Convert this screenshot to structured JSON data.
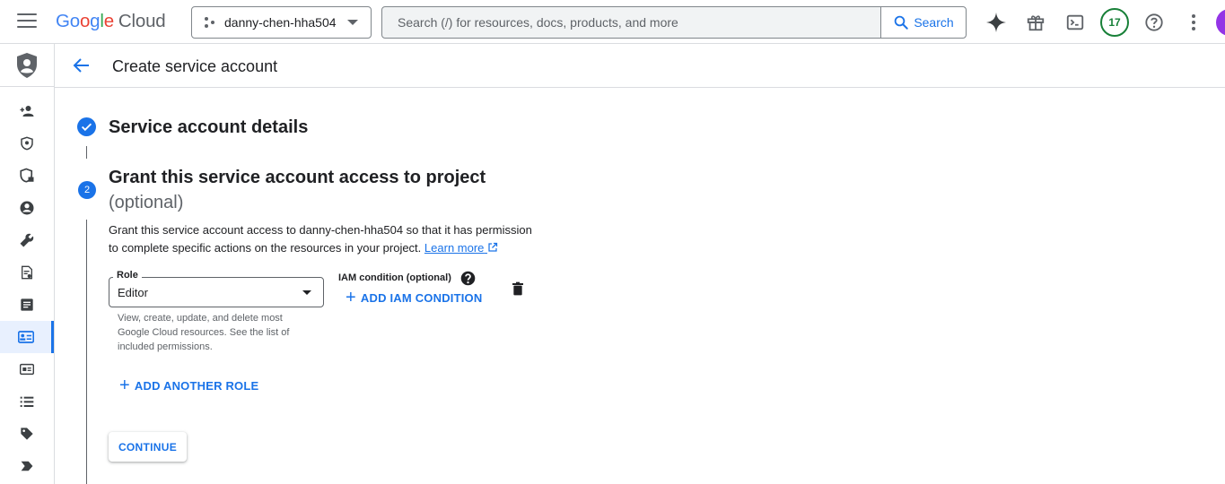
{
  "topbar": {
    "logo_g": "Go",
    "logo_o": "o",
    "logo_g2": "g",
    "logo_l": "l",
    "logo_e": "e",
    "logo_cloud": "Cloud",
    "project_name": "danny-chen-hha504",
    "search_placeholder": "Search (/) for resources, docs, products, and more",
    "search_button": "Search",
    "notifications_count": "17"
  },
  "header": {
    "title": "Create service account"
  },
  "steps": {
    "step1_title": "Service account details",
    "step2_number": "2",
    "step2_title": "Grant this service account access to project",
    "step2_optional": "(optional)",
    "description": "Grant this service account access to danny-chen-hha504 so that it has permission to complete specific actions on the resources in your project.",
    "learn_more": "Learn more"
  },
  "role": {
    "label": "Role",
    "value": "Editor",
    "help": "View, create, update, and delete most Google Cloud resources. See the list of included permissions."
  },
  "iam": {
    "label": "IAM condition (optional)",
    "add_condition": "ADD IAM CONDITION"
  },
  "actions": {
    "add_another_role": "ADD ANOTHER ROLE",
    "continue": "CONTINUE"
  },
  "colors": {
    "accent": "#1a73e8",
    "badge_green": "#188038",
    "avatar": "#9334e6"
  }
}
